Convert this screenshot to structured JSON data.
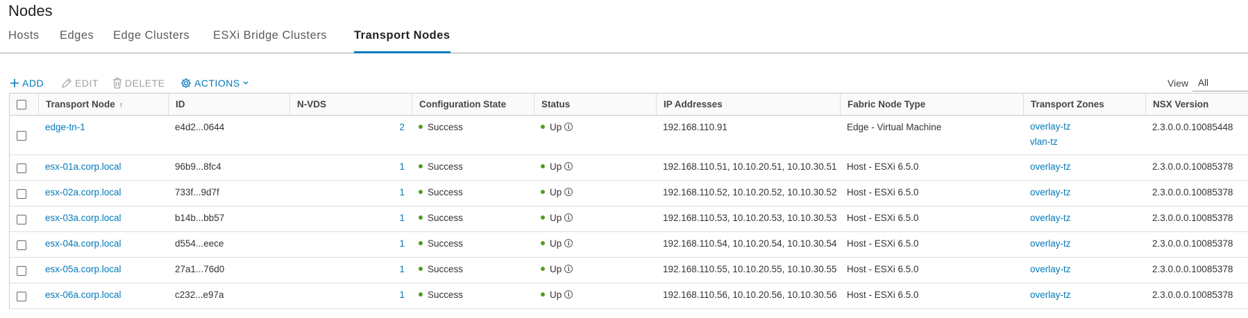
{
  "page": {
    "title": "Nodes"
  },
  "tabs": [
    {
      "label": "Hosts",
      "active": false
    },
    {
      "label": "Edges",
      "active": false
    },
    {
      "label": "Edge Clusters",
      "active": false
    },
    {
      "label": "ESXi Bridge Clusters",
      "active": false
    },
    {
      "label": "Transport Nodes",
      "active": true
    }
  ],
  "toolbar": {
    "add_label": "ADD",
    "edit_label": "EDIT",
    "delete_label": "DELETE",
    "actions_label": "ACTIONS",
    "view_label": "View",
    "view_value": "All"
  },
  "colors": {
    "accent": "#0079b8",
    "status_ok": "#4e9d1d",
    "disabled": "#a0a0a0"
  },
  "table": {
    "columns": [
      "Transport Node",
      "ID",
      "N-VDS",
      "Configuration State",
      "Status",
      "IP Addresses",
      "Fabric Node Type",
      "Transport Zones",
      "NSX Version"
    ],
    "sort_icon": "sort-ascending-icon",
    "rows": [
      {
        "name": "edge-tn-1",
        "id": "e4d2...0644",
        "nvds": "2",
        "config": "Success",
        "status": "Up",
        "ips": "192.168.110.91",
        "type": "Edge - Virtual Machine",
        "zone1": "overlay-tz",
        "zone2": "vlan-tz",
        "version": "2.3.0.0.0.10085448"
      },
      {
        "name": "esx-01a.corp.local",
        "id": "96b9...8fc4",
        "nvds": "1",
        "config": "Success",
        "status": "Up",
        "ips": "192.168.110.51, 10.10.20.51, 10.10.30.51",
        "type": "Host - ESXi 6.5.0",
        "zone1": "overlay-tz",
        "version": "2.3.0.0.0.10085378"
      },
      {
        "name": "esx-02a.corp.local",
        "id": "733f...9d7f",
        "nvds": "1",
        "config": "Success",
        "status": "Up",
        "ips": "192.168.110.52, 10.10.20.52, 10.10.30.52",
        "type": "Host - ESXi 6.5.0",
        "zone1": "overlay-tz",
        "version": "2.3.0.0.0.10085378"
      },
      {
        "name": "esx-03a.corp.local",
        "id": "b14b...bb57",
        "nvds": "1",
        "config": "Success",
        "status": "Up",
        "ips": "192.168.110.53, 10.10.20.53, 10.10.30.53",
        "type": "Host - ESXi 6.5.0",
        "zone1": "overlay-tz",
        "version": "2.3.0.0.0.10085378"
      },
      {
        "name": "esx-04a.corp.local",
        "id": "d554...eece",
        "nvds": "1",
        "config": "Success",
        "status": "Up",
        "ips": "192.168.110.54, 10.10.20.54, 10.10.30.54",
        "type": "Host - ESXi 6.5.0",
        "zone1": "overlay-tz",
        "version": "2.3.0.0.0.10085378"
      },
      {
        "name": "esx-05a.corp.local",
        "id": "27a1...76d0",
        "nvds": "1",
        "config": "Success",
        "status": "Up",
        "ips": "192.168.110.55, 10.10.20.55, 10.10.30.55",
        "type": "Host - ESXi 6.5.0",
        "zone1": "overlay-tz",
        "version": "2.3.0.0.0.10085378"
      },
      {
        "name": "esx-06a.corp.local",
        "id": "c232...e97a",
        "nvds": "1",
        "config": "Success",
        "status": "Up",
        "ips": "192.168.110.56, 10.10.20.56, 10.10.30.56",
        "type": "Host - ESXi 6.5.0",
        "zone1": "overlay-tz",
        "version": "2.3.0.0.0.10085378"
      }
    ]
  }
}
